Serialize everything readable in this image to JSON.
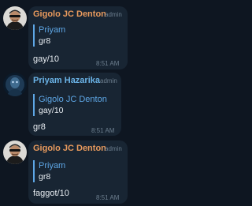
{
  "colors": {
    "background": "#0e1621",
    "bubble": "#182533",
    "sender_orange": "#e89a5d",
    "sender_blue": "#6bb4e8",
    "reply_accent": "#5ea7e6",
    "muted": "#6d7f8f",
    "text": "#e8edf2"
  },
  "messages": [
    {
      "sender": "Gigolo JC Denton",
      "role": "admin",
      "reply_to_name": "Priyam",
      "reply_to_text": "gr8",
      "text": "gay/10",
      "time": "8:51 AM",
      "avatar_icon": "masked-man-avatar-icon"
    },
    {
      "sender": "Priyam Hazarika",
      "role": "admin",
      "reply_to_name": "Gigolo JC Denton",
      "reply_to_text": "gay/10",
      "text": "gr8",
      "time": "8:51 AM",
      "avatar_icon": "dark-portrait-avatar-icon"
    },
    {
      "sender": "Gigolo JC Denton",
      "role": "admin",
      "reply_to_name": "Priyam",
      "reply_to_text": "gr8",
      "text": "faggot/10",
      "time": "8:51 AM",
      "avatar_icon": "masked-man-avatar-icon"
    }
  ]
}
